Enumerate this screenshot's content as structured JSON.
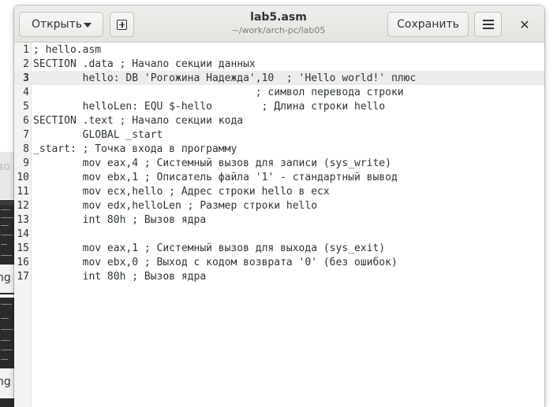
{
  "window": {
    "title": "lab5.asm",
    "subtitle": "~/work/arch-pc/lab05",
    "open_label": "Открыть",
    "save_label": "Сохранить",
    "close_glyph": "✕"
  },
  "background": {
    "fragment_1": "во",
    "fragment_2": "ng",
    "fragment_3": "ng"
  },
  "editor": {
    "current_line": 3,
    "lines": [
      {
        "num": "1",
        "text": "; hello.asm"
      },
      {
        "num": "2",
        "text": "SECTION .data ; Начало секции данных"
      },
      {
        "num": "3",
        "text": "        hello: DB 'Рогожина Надежда',10  ; 'Hello world!' плюс"
      },
      {
        "num": "4",
        "text": "                                    ; символ перевода строки"
      },
      {
        "num": "5",
        "text": "        helloLen: EQU $-hello        ; Длина строки hello"
      },
      {
        "num": "6",
        "text": "SECTION .text ; Начало секции кода"
      },
      {
        "num": "7",
        "text": "        GLOBAL _start"
      },
      {
        "num": "8",
        "text": "_start: ; Точка входа в программу"
      },
      {
        "num": "9",
        "text": "        mov eax,4 ; Системный вызов для записи (sys_write)"
      },
      {
        "num": "10",
        "text": "        mov ebx,1 ; Описатель файла '1' - стандартный вывод"
      },
      {
        "num": "11",
        "text": "        mov ecx,hello ; Адрес строки hello в ecx"
      },
      {
        "num": "12",
        "text": "        mov edx,helloLen ; Размер строки hello"
      },
      {
        "num": "13",
        "text": "        int 80h ; Вызов ядра"
      },
      {
        "num": "14",
        "text": ""
      },
      {
        "num": "15",
        "text": "        mov eax,1 ; Системный вызов для выхода (sys_exit)"
      },
      {
        "num": "16",
        "text": "        mov ebx,0 ; Выход с кодом возврата '0' (без ошибок)"
      },
      {
        "num": "17",
        "text": "        int 80h ; Вызов ядра"
      }
    ]
  }
}
